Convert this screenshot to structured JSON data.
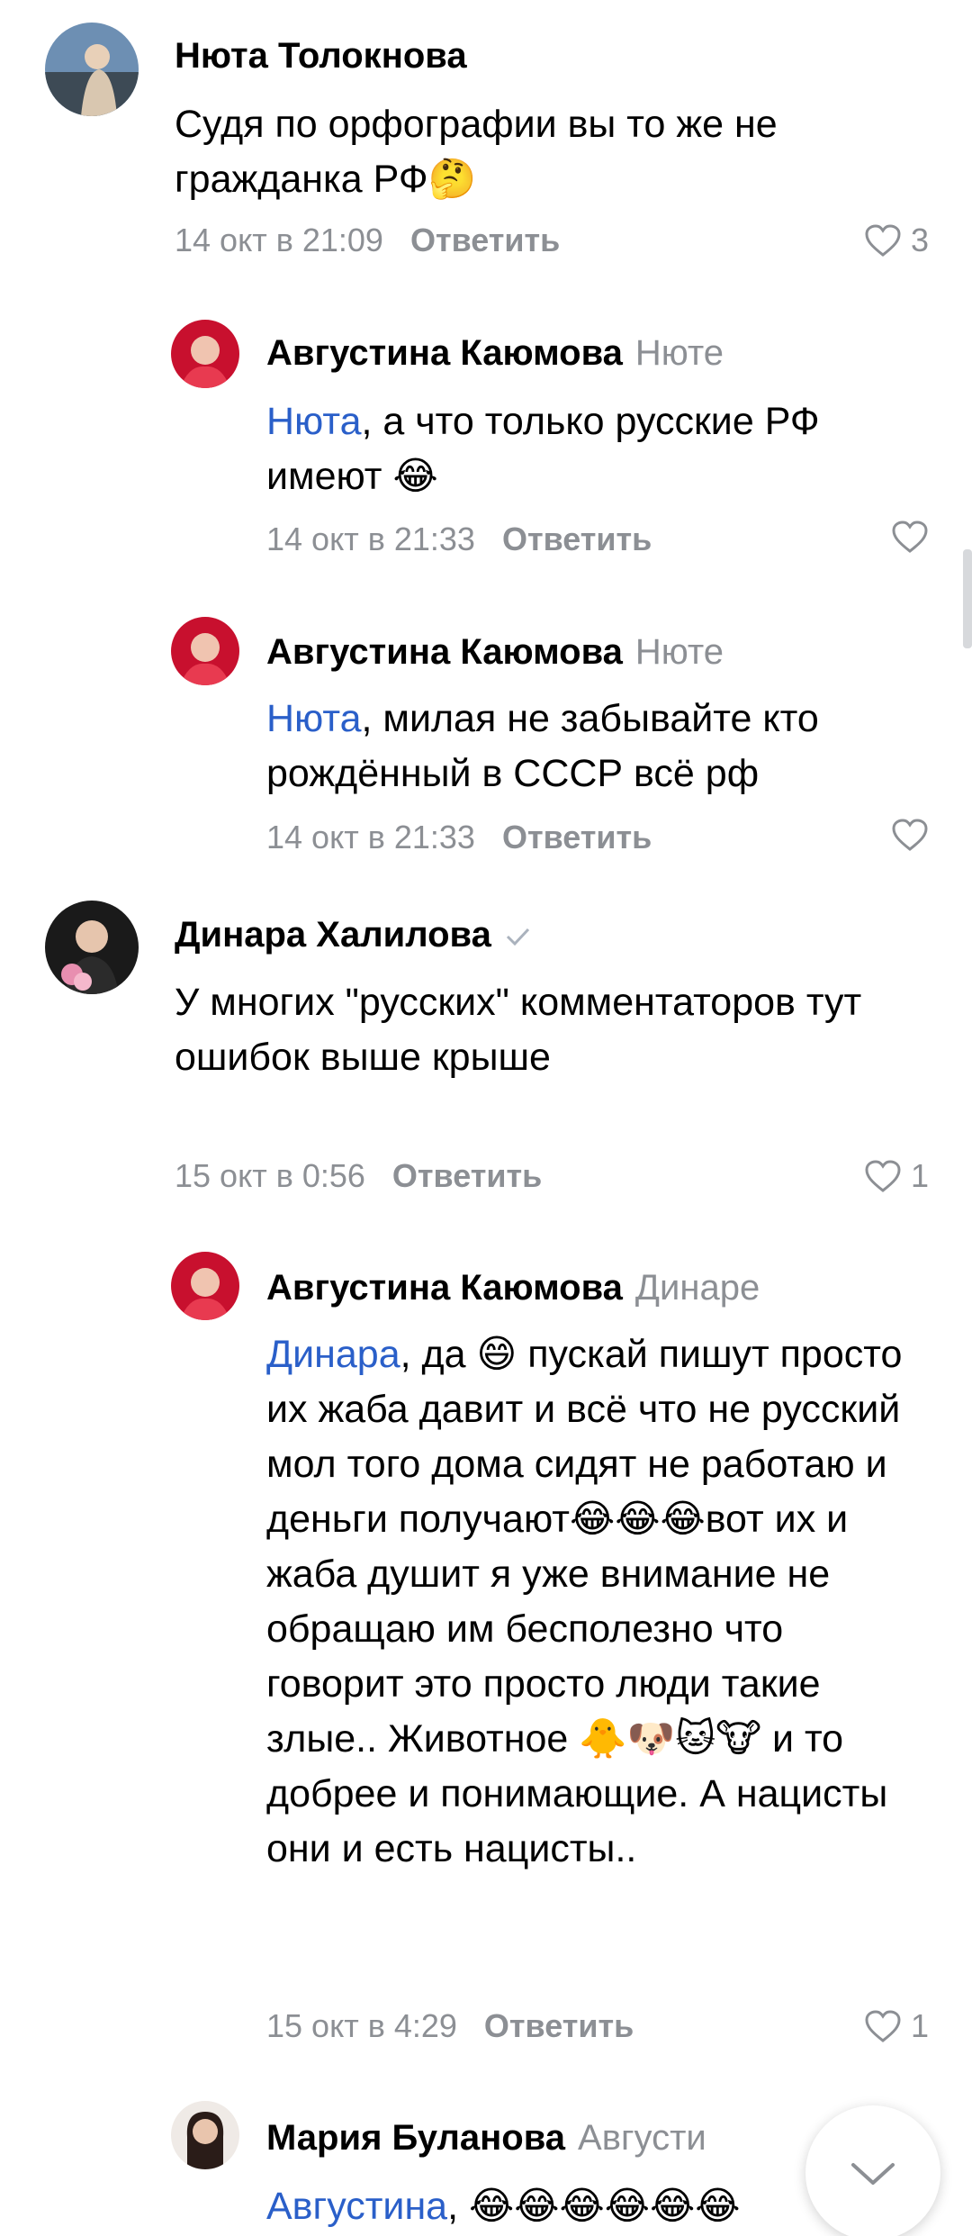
{
  "comments": [
    {
      "author": "Нюта Толокнова",
      "reply_to": "",
      "text": "Судя по орфографии вы то же не гражданка РФ🤔",
      "time": "14 окт в 21:09",
      "reply_label": "Ответить",
      "likes": "3"
    },
    {
      "author": "Августина Каюмова",
      "reply_to": "Нюте",
      "mention": "Нюта",
      "text": ", а что только русские РФ  имеют 😂",
      "time": "14 окт в 21:33",
      "reply_label": "Ответить",
      "likes": ""
    },
    {
      "author": "Августина Каюмова",
      "reply_to": "Нюте",
      "mention": "Нюта",
      "text": ", милая не забывайте кто рождённый в СССР всё рф",
      "time": "14 окт в 21:33",
      "reply_label": "Ответить",
      "likes": ""
    },
    {
      "author": "Динара Халилова",
      "reply_to": "",
      "text": "У многих \"русских\" комментаторов тут ошибок выше крыше",
      "time": "15 окт в 0:56",
      "reply_label": "Ответить",
      "likes": "1"
    },
    {
      "author": "Августина Каюмова",
      "reply_to": "Динаре",
      "mention": "Динара",
      "text_parts": [
        ", да 😄 пускай пишут просто их жаба давит и всё что не русский мол того дома сидят не работаю и деньги получают😂😂😂вот их и жаба душит я уже внимание не обращаю им бесполезно что говорит это просто люди такие злые.. Животное 🐥🐶🐱🐮 и то добрее и понимающие. А нацисты они и есть нацисты.."
      ],
      "time": "15 окт в 4:29",
      "reply_label": "Ответить",
      "likes": "1"
    },
    {
      "author": "Мария Буланова",
      "reply_to": "Августи",
      "mention": "Августина",
      "text": ", 😂😂😂😂😂😂",
      "time": "",
      "reply_label": "",
      "likes": ""
    }
  ],
  "colors": {
    "accent": "#2a5fc9",
    "muted": "#8c8f94",
    "verified": "#aab2bd"
  },
  "icons": {
    "like": "heart-outline-icon",
    "verified": "check-icon",
    "scroll_down": "chevron-down-icon"
  }
}
